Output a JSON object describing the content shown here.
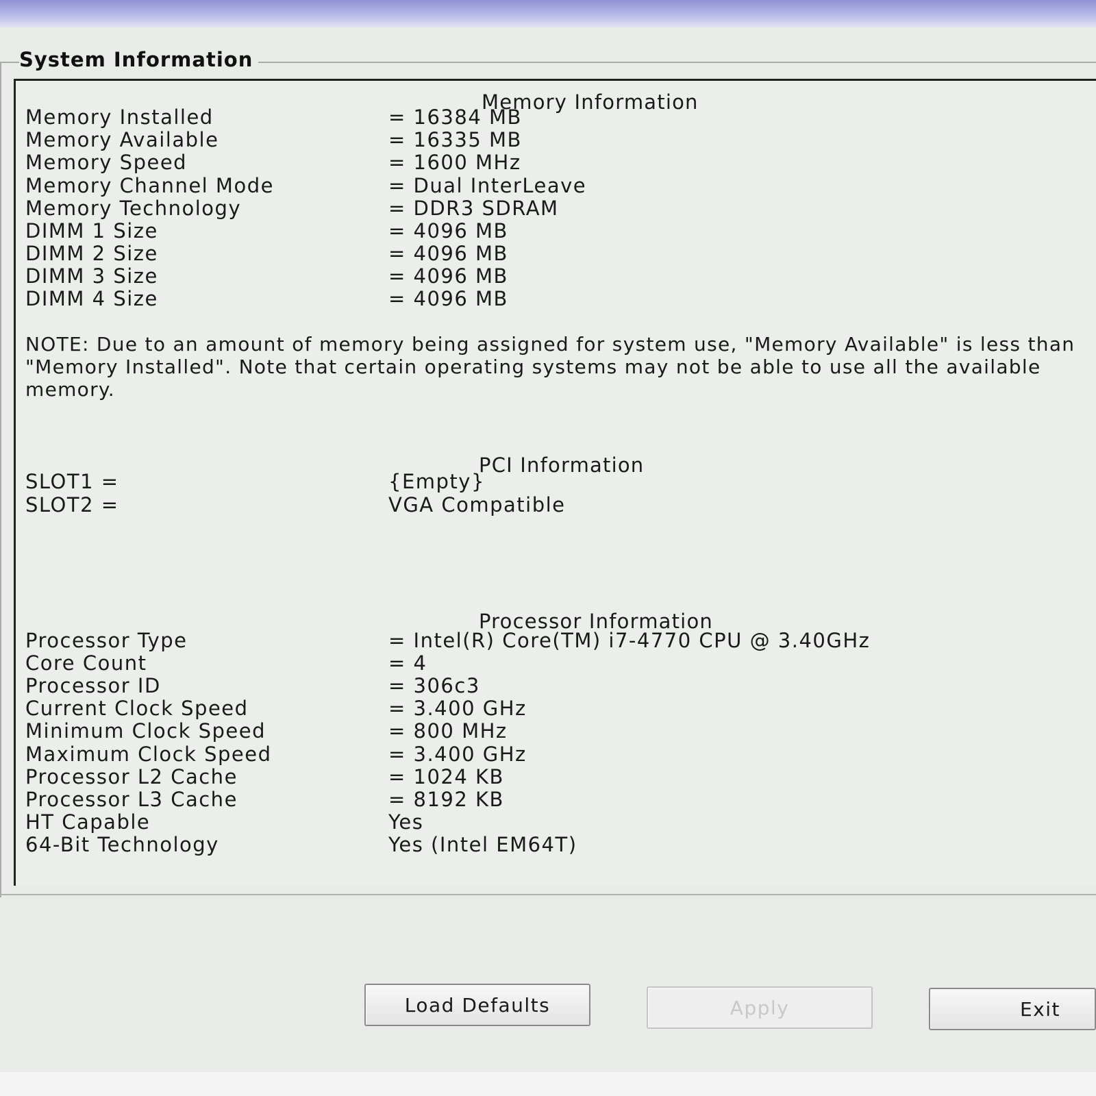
{
  "window": {
    "group_title": "System Information"
  },
  "memory": {
    "title": "Memory Information",
    "rows": [
      {
        "label": "Memory Installed",
        "value": "= 16384 MB"
      },
      {
        "label": "Memory Available",
        "value": "= 16335 MB"
      },
      {
        "label": "Memory Speed",
        "value": "= 1600 MHz"
      },
      {
        "label": "Memory Channel Mode",
        "value": "= Dual InterLeave"
      },
      {
        "label": "Memory Technology",
        "value": "= DDR3 SDRAM"
      },
      {
        "label": "DIMM 1 Size",
        "value": "= 4096 MB"
      },
      {
        "label": "DIMM 2 Size",
        "value": "= 4096 MB"
      },
      {
        "label": "DIMM 3 Size",
        "value": "= 4096 MB"
      },
      {
        "label": "DIMM 4 Size",
        "value": "= 4096 MB"
      }
    ],
    "note": "NOTE: Due to an amount of memory being assigned for system use, \"Memory Available\" is less than \"Memory Installed\". Note that certain operating systems may not be able to use all the available memory."
  },
  "pci": {
    "title": "PCI Information",
    "rows": [
      {
        "label": "SLOT1 =",
        "value": "{Empty}"
      },
      {
        "label": "SLOT2 =",
        "value": "VGA Compatible"
      }
    ]
  },
  "processor": {
    "title": "Processor Information",
    "rows": [
      {
        "label": "Processor Type",
        "value": "= Intel(R) Core(TM) i7-4770 CPU @ 3.40GHz"
      },
      {
        "label": "Core Count",
        "value": "= 4"
      },
      {
        "label": "Processor ID",
        "value": "= 306c3"
      },
      {
        "label": "Current Clock Speed",
        "value": "= 3.400 GHz"
      },
      {
        "label": "Minimum Clock Speed",
        "value": "= 800 MHz"
      },
      {
        "label": "Maximum Clock Speed",
        "value": "= 3.400 GHz"
      },
      {
        "label": "Processor L2 Cache",
        "value": "= 1024 KB"
      },
      {
        "label": "Processor L3 Cache",
        "value": "= 8192 KB"
      },
      {
        "label": "HT Capable",
        "value": "Yes"
      },
      {
        "label": "64-Bit Technology",
        "value": "Yes (Intel EM64T)"
      }
    ]
  },
  "buttons": {
    "load_defaults": "Load Defaults",
    "apply": "Apply",
    "exit": "Exit"
  }
}
